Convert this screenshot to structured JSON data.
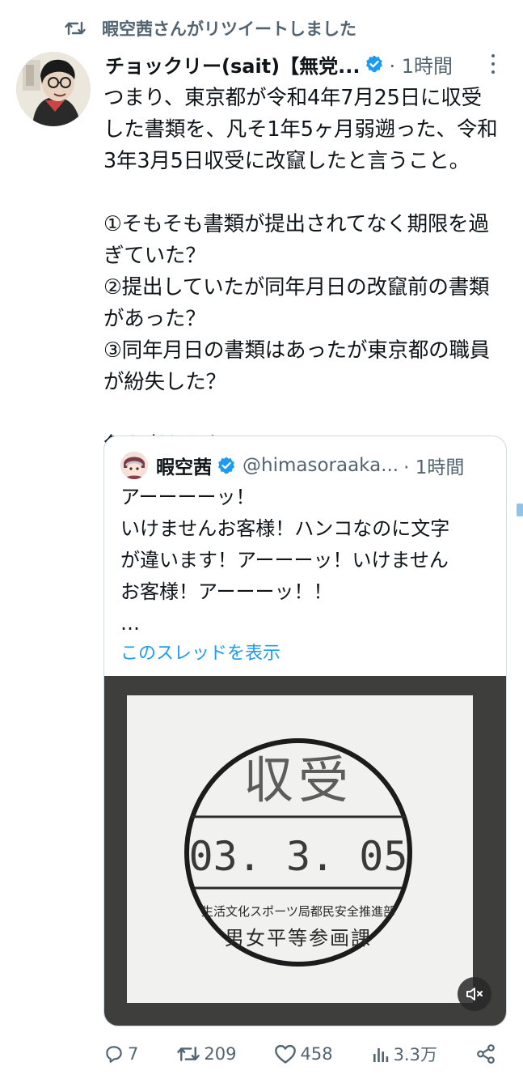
{
  "retweet": {
    "text": "暇空茜さんがリツイートしました",
    "icon": "retweet-icon"
  },
  "tweet": {
    "author_name": "チョックリー(sait)【無党...",
    "time": "· 1時間",
    "body": "つまり、東京都が令和4年7月25日に収受\nした書類を、凡そ1年5ヶ月弱遡った、令和\n3年3月5日収受に改竄したと言うこと。\n\n①そもそも書類が提出されてなく期限を過\nぎていた？\n②提出していたが同年月日の改竄前の書類\nがあった？\n③同年月日の書類はあったが東京都の職員\nが紛失した？\n\n色々考えられる。",
    "stats": {
      "replies": "7",
      "retweets": "209",
      "likes": "458",
      "views": "3.3万"
    }
  },
  "quote": {
    "author_name": "暇空茜",
    "handle": "@himasoraaka...",
    "time": "· 1時間",
    "body": "アーーーーッ！\nいけませんお客様！ハンコなのに文字\nが違います！アーーーッ！いけません\nお客様！アーーーッ！！\n…",
    "show_thread": "このスレッドを表示",
    "stamp": {
      "top_text": "収受",
      "date_text": "03. 3. 05",
      "line1": "生活文化スポーツ局都民安全推進部",
      "line2": "男女平等参画課"
    }
  },
  "colors": {
    "accent": "#1d9bf0",
    "muted": "#536471",
    "text": "#0f1419",
    "border": "#cfd9de"
  }
}
